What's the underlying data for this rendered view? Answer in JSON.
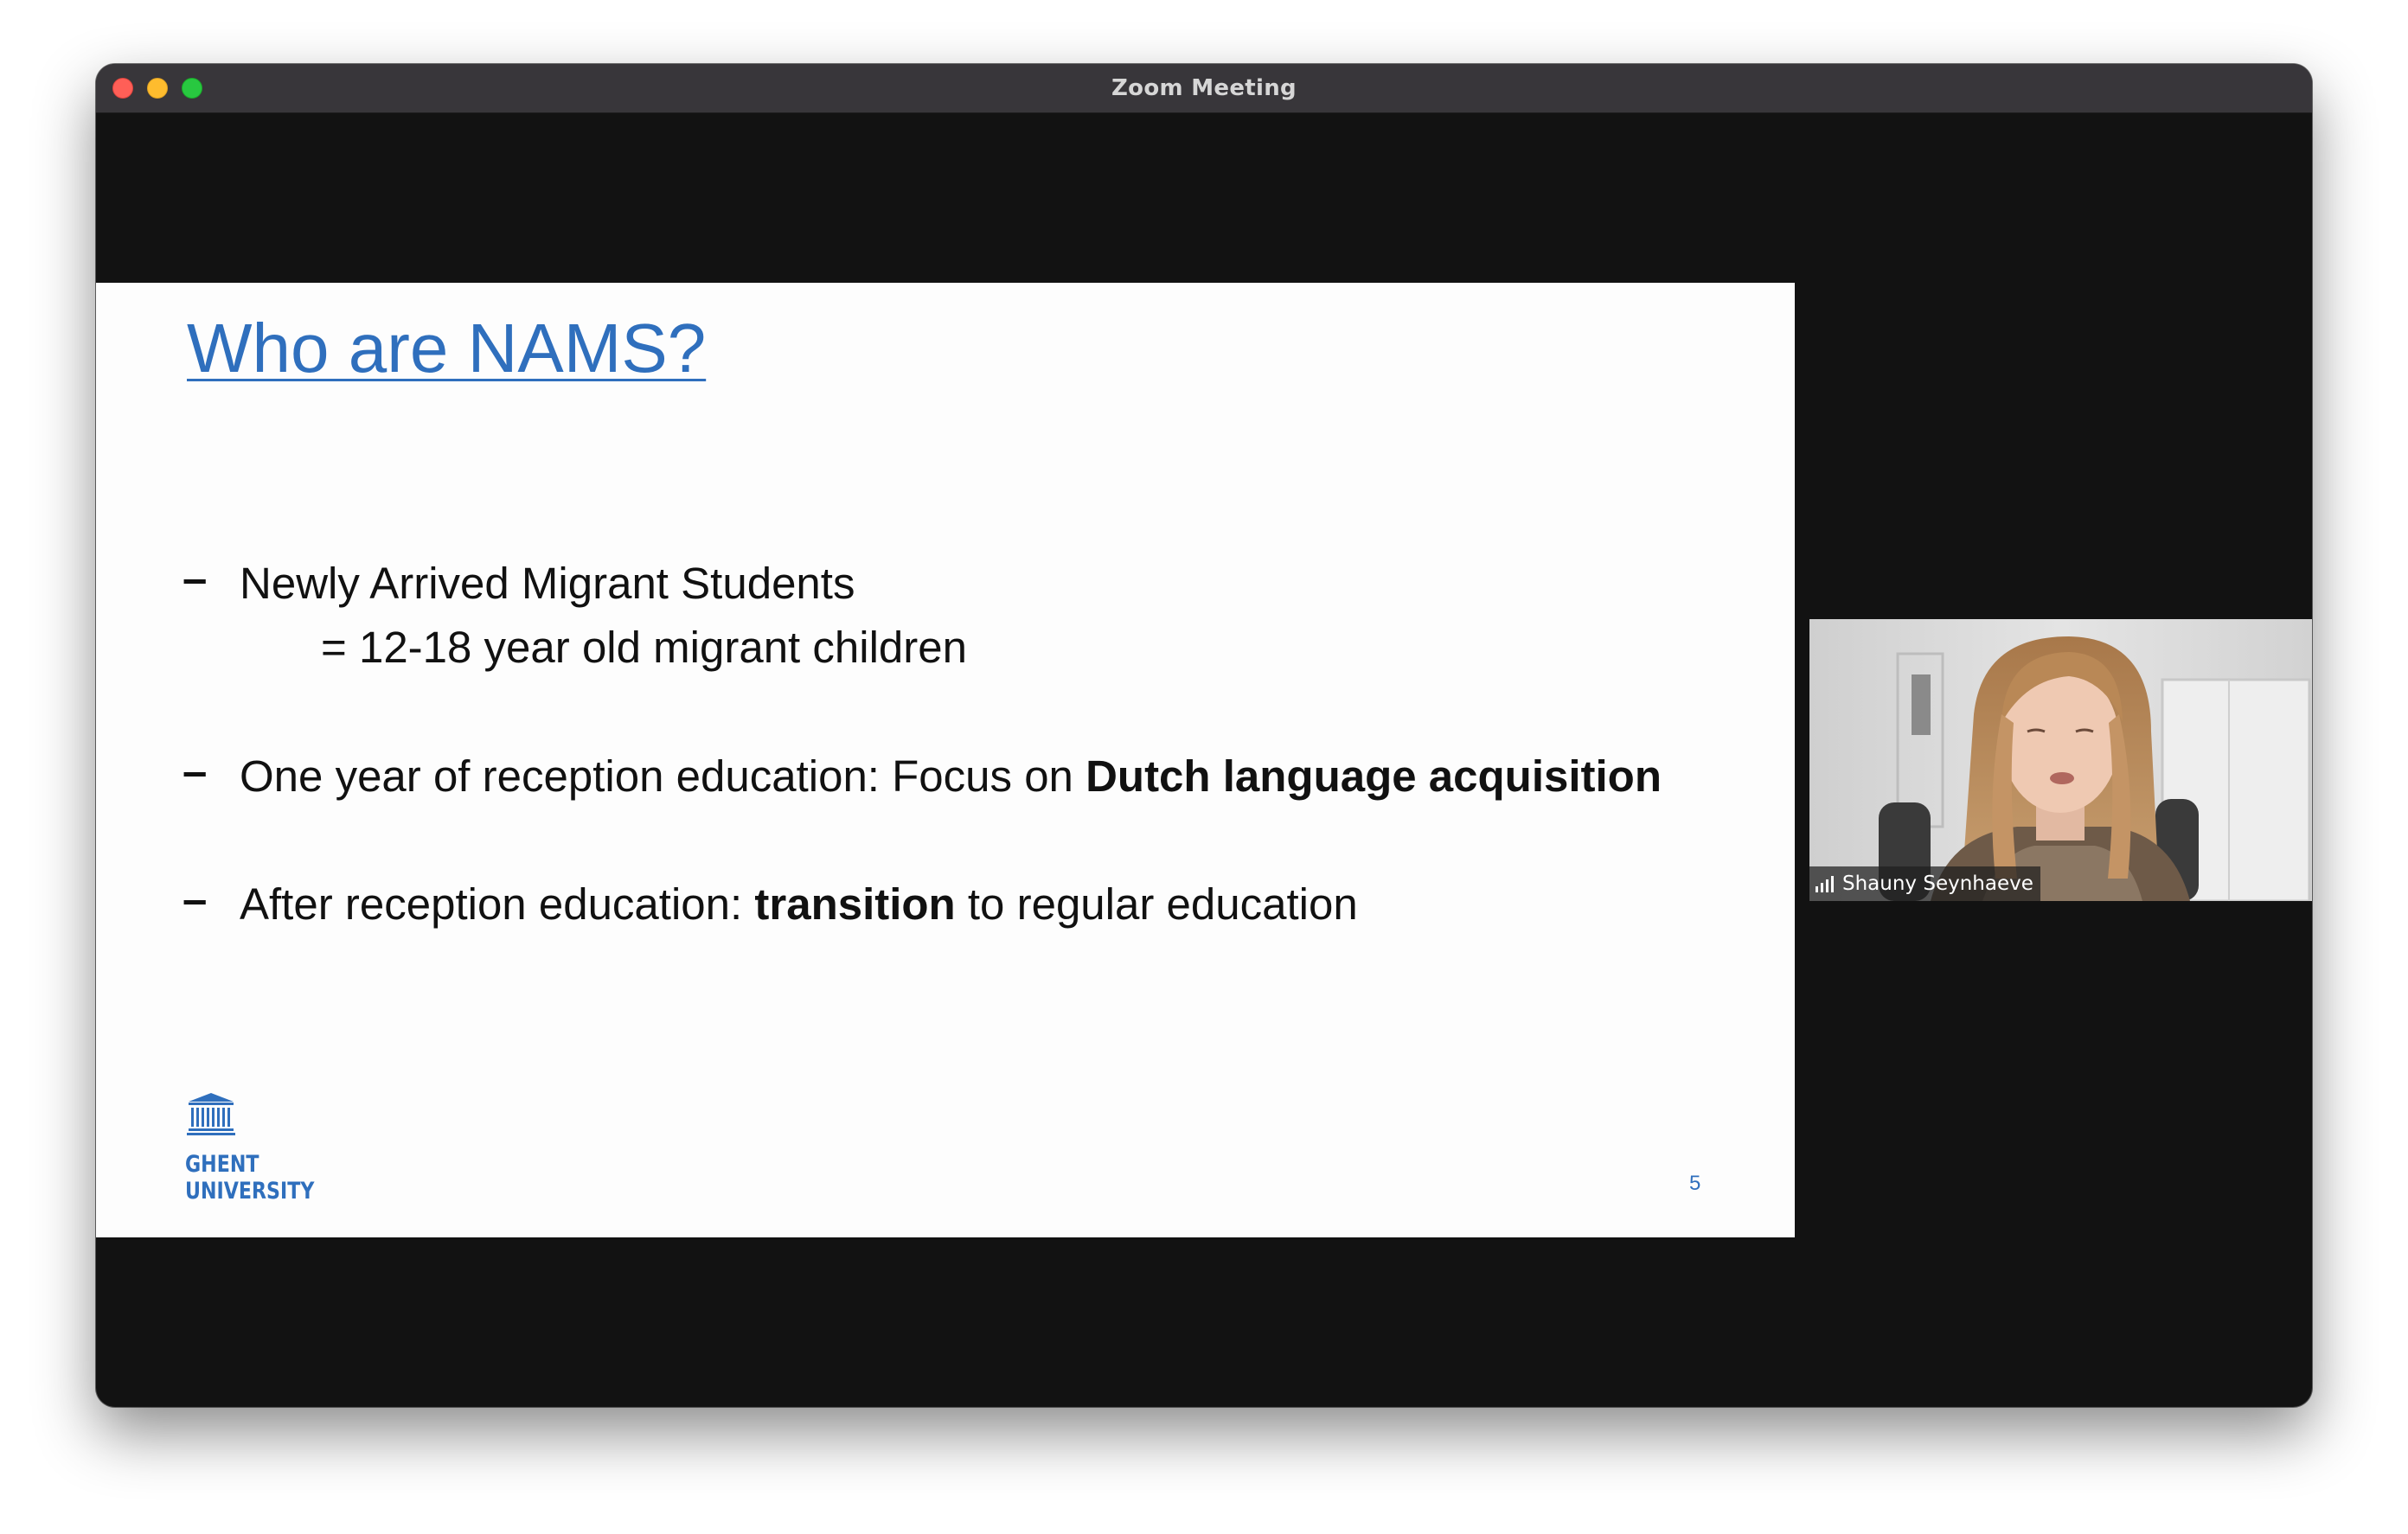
{
  "window": {
    "title": "Zoom Meeting"
  },
  "slide": {
    "title": "Who are NAMS?",
    "bullets": [
      {
        "text": "Newly Arrived Migrant Students",
        "sub": "= 12-18 year old migrant children"
      },
      {
        "prefix": "One year of reception education: Focus on ",
        "bold": "Dutch language acquisition",
        "suffix": ""
      },
      {
        "prefix": "After reception education: ",
        "bold": "transition",
        "suffix": " to regular education"
      }
    ],
    "dash": "–",
    "logo": {
      "line1": "GHENT",
      "line2": "UNIVERSITY"
    },
    "page_number": "5"
  },
  "participant": {
    "name": "Shauny Seynhaeve"
  },
  "colors": {
    "slide_accent": "#2f6fbd",
    "window_bg": "#121212",
    "titlebar_bg": "#38363a"
  }
}
